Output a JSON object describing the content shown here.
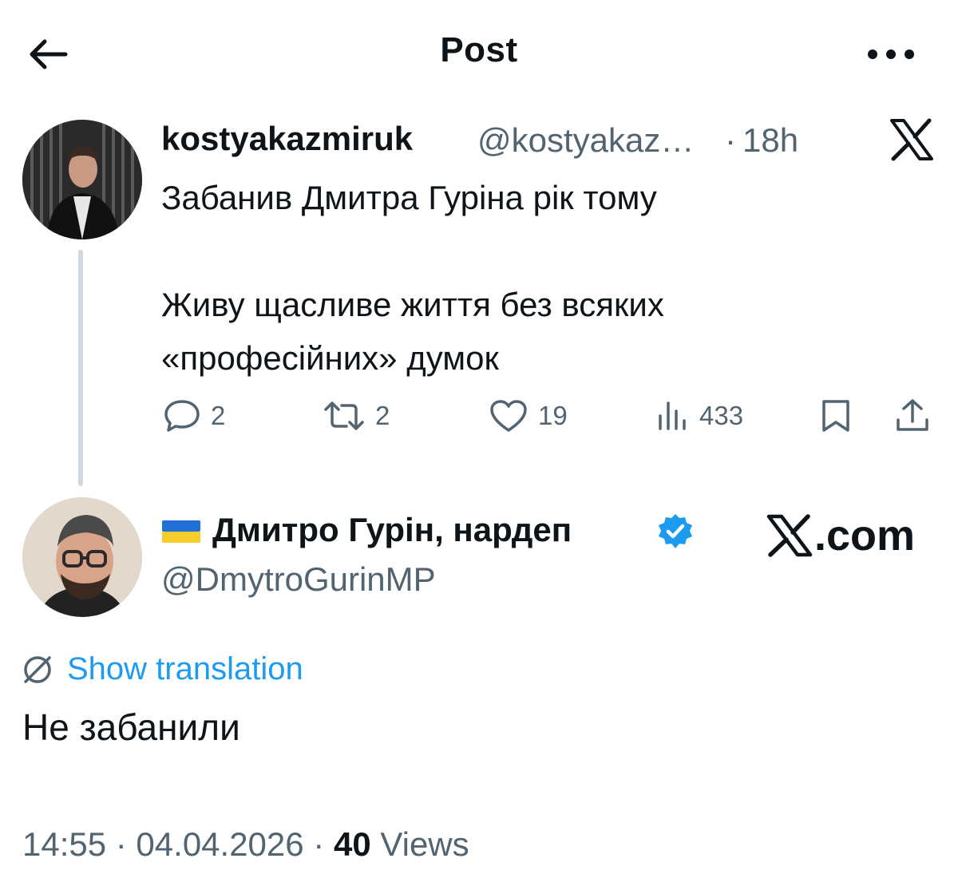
{
  "header": {
    "title": "Post",
    "back_icon": "arrow-left-icon",
    "more_icon": "more-horizontal-icon"
  },
  "parent_tweet": {
    "display_name": "kostyakazmiruk",
    "handle": "@kostyakaz…",
    "separator": "·",
    "time": "18h",
    "text": "Забанив Дмитра Гуріна рік тому\n\nЖиву щасливе життя без всяких\n«професійних» думок",
    "platform_icon": "x-logo-icon",
    "actions": {
      "replies": "2",
      "reposts": "2",
      "likes": "19",
      "views": "433"
    }
  },
  "reply_tweet": {
    "flag_icon": "ukraine-flag-icon",
    "display_name": "Дмитро Гурін, нардеп",
    "verified_icon": "verified-badge-icon",
    "handle": "@DmytroGurinMP",
    "watermark": ".com",
    "translate_label": "Show translation",
    "text": "Не забанили",
    "timestamp": "14:55 · 04.04.2026 · ",
    "views_count": "40",
    "views_label": " Views"
  },
  "colors": {
    "text": "#0f1419",
    "secondary": "#536471",
    "accent": "#1d9bf0",
    "thread_line": "#cfd9de"
  }
}
